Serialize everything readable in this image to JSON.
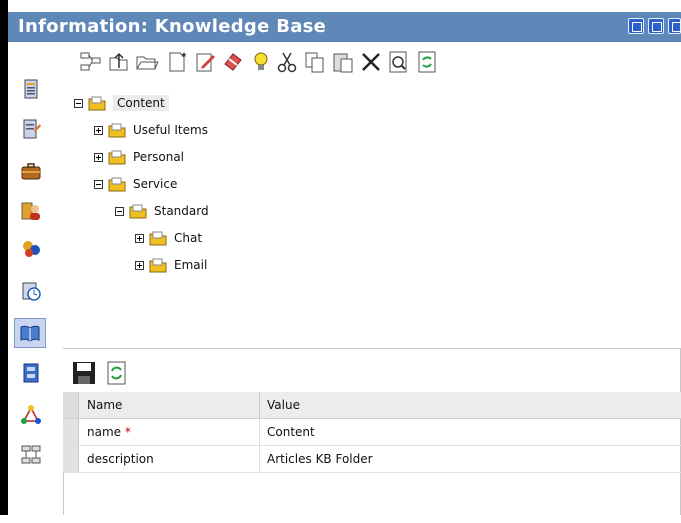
{
  "window": {
    "title": "Information: Knowledge Base"
  },
  "sidebar": {
    "items": [
      {
        "icon": "document-icon"
      },
      {
        "icon": "document-edit-icon"
      },
      {
        "icon": "briefcase-icon"
      },
      {
        "icon": "contacts-icon"
      },
      {
        "icon": "users-icon"
      },
      {
        "icon": "schedule-icon"
      },
      {
        "icon": "knowledge-book-icon",
        "selected": true
      },
      {
        "icon": "cabinet-icon"
      },
      {
        "icon": "network-icon"
      },
      {
        "icon": "hierarchy-icon"
      }
    ]
  },
  "toolbar": {
    "buttons": [
      "structure-icon",
      "up-folder-icon",
      "open-folder-icon",
      "new-document-icon",
      "edit-icon",
      "erase-icon",
      "lightbulb-icon",
      "cut-icon",
      "copy-icon",
      "paste-icon",
      "delete-icon",
      "find-icon",
      "refresh-icon"
    ]
  },
  "tree": {
    "root": "Content",
    "nodes": {
      "useful_items": "Useful Items",
      "personal": "Personal",
      "service": "Service",
      "standard": "Standard",
      "chat": "Chat",
      "email": "Email"
    }
  },
  "properties": {
    "headers": {
      "name": "Name",
      "value": "Value"
    },
    "rows": [
      {
        "name": "name",
        "required_mark": "*",
        "value": "Content"
      },
      {
        "name": "description",
        "required_mark": "",
        "value": "Articles KB Folder"
      }
    ]
  },
  "colors": {
    "titlebar": "#5f88b8",
    "folder": "#f0c020",
    "required": "#cc0000"
  }
}
